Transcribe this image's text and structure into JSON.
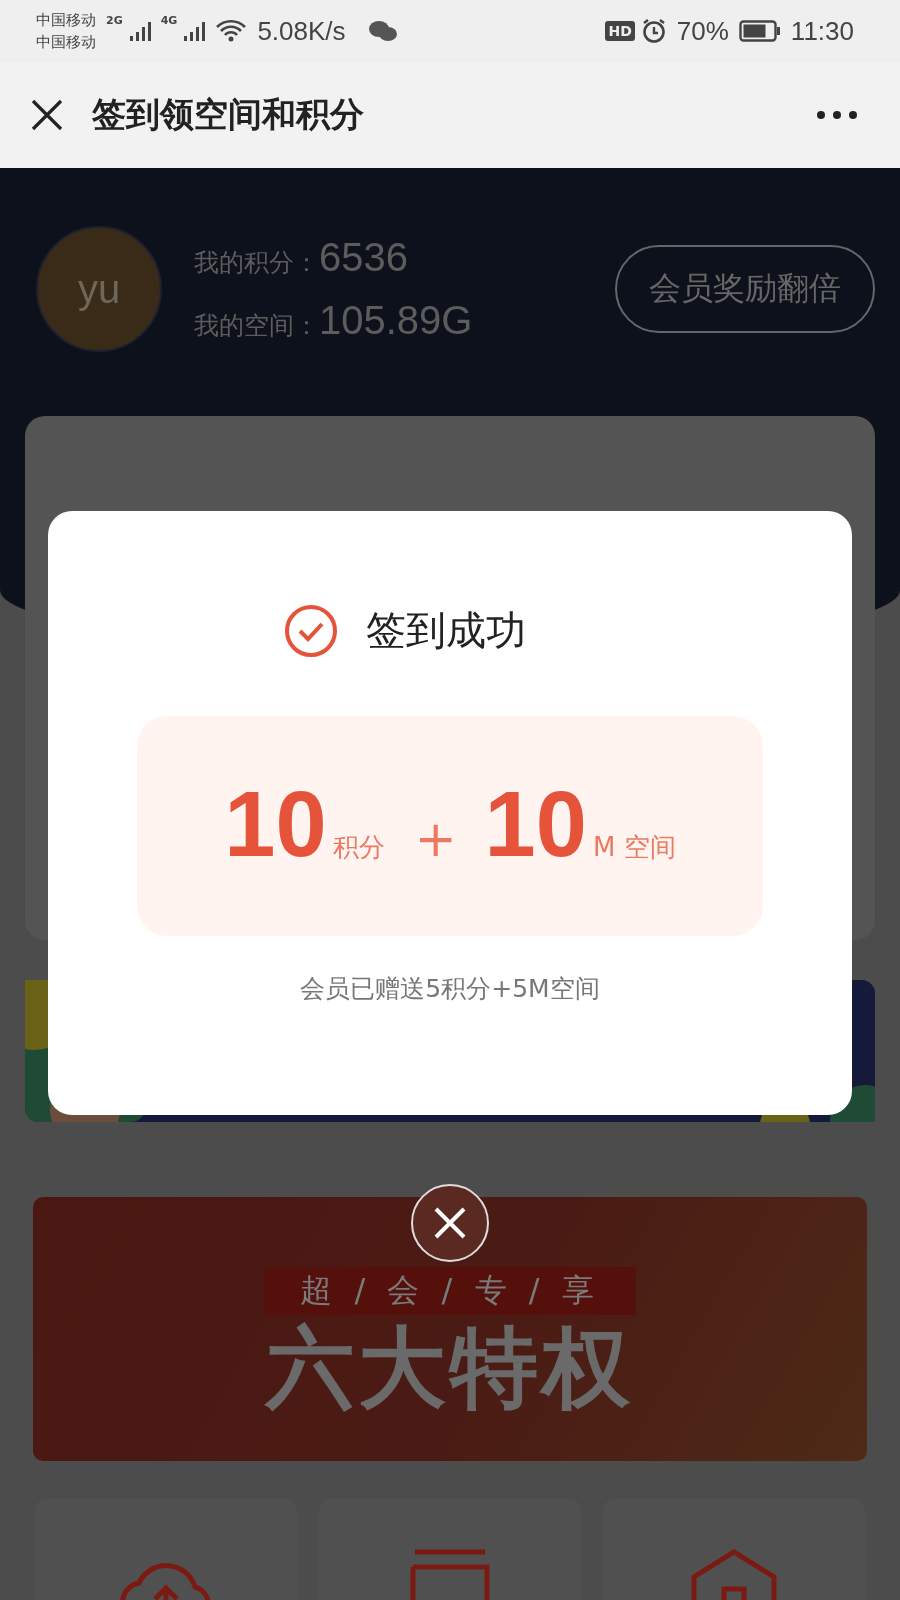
{
  "status_bar": {
    "carriers": [
      "中国移动",
      "中国移动"
    ],
    "networks": [
      "2G",
      "4G"
    ],
    "speed": "5.08K/s",
    "hd": "HD",
    "battery": "70%",
    "time": "11:30"
  },
  "nav": {
    "title": "签到领空间和积分"
  },
  "profile": {
    "avatar": "yu",
    "points_label": "我的积分：",
    "points": "6536",
    "space_label": "我的空间：",
    "space": "105.89G",
    "vip_button": "会员奖励翻倍"
  },
  "banner": {
    "tagline": "超 / 会 / 专 / 享",
    "headline": "六大特权"
  },
  "dialog": {
    "title": "签到成功",
    "rewards": [
      {
        "amount": "10",
        "unit": "积分"
      },
      {
        "amount": "10",
        "unit": "M 空间"
      }
    ],
    "plus": "+",
    "note": "会员已赠送5积分+5M空间"
  }
}
